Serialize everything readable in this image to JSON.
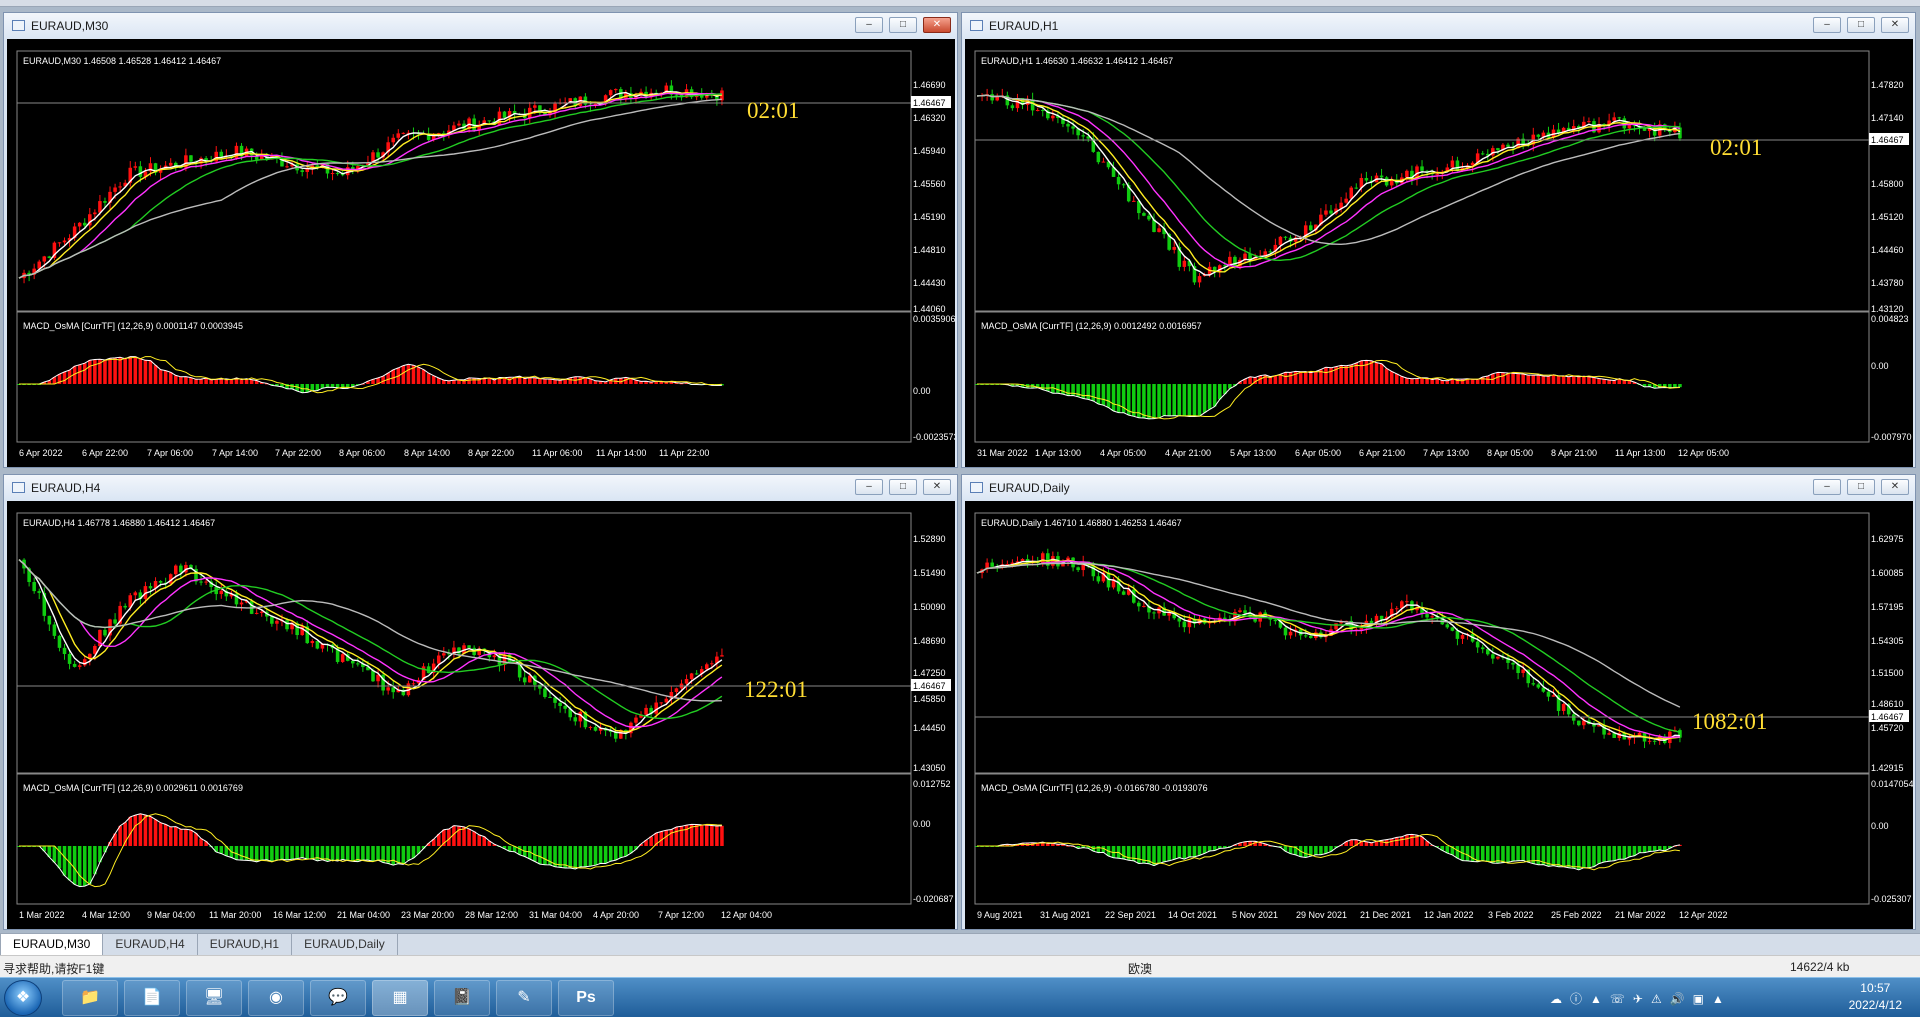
{
  "colors": {
    "bull": "#ff1010",
    "bear": "#10cc10",
    "ma_fast": "#ffffff",
    "ma_mid": "#ffee22",
    "ma_slow": "#ff33ff",
    "ma_slower": "#22cc22",
    "ma_slowest": "#bbbbbb",
    "countdown": "#ffdd33"
  },
  "windows": [
    {
      "title": "EURAUD,M30",
      "info": "EURAUD,M30  1.46508 1.46528 1.46412 1.46467",
      "macd_info": "MACD_OsMA [CurrTF] (12,26,9) 0.0001147 0.0003945",
      "current_price_label": "1.46467",
      "countdown": "02:01",
      "price_ticks": [
        "1.46690",
        "1.46320",
        "1.45940",
        "1.45560",
        "1.45190",
        "1.44810",
        "1.44430",
        "1.44060"
      ],
      "macd_ticks": [
        "0.0035906",
        "0.00",
        "-0.0023573"
      ],
      "time_ticks": [
        "6 Apr 2022",
        "6 Apr 22:00",
        "7 Apr 06:00",
        "7 Apr 14:00",
        "7 Apr 22:00",
        "8 Apr 06:00",
        "8 Apr 14:00",
        "8 Apr 22:00",
        "11 Apr 06:00",
        "11 Apr 14:00",
        "11 Apr 22:00"
      ]
    },
    {
      "title": "EURAUD,H1",
      "info": "EURAUD,H1  1.46630 1.46632 1.46412 1.46467",
      "macd_info": "MACD_OsMA [CurrTF] (12,26,9) 0.0012492 0.0016957",
      "current_price_label": "1.46467",
      "countdown": "02:01",
      "price_ticks": [
        "1.47820",
        "1.47140",
        "1.45800",
        "1.45120",
        "1.44460",
        "1.43780",
        "1.43120"
      ],
      "macd_ticks": [
        "0.004823",
        "0.00",
        "-0.007970"
      ],
      "time_ticks": [
        "31 Mar 2022",
        "1 Apr 13:00",
        "4 Apr 05:00",
        "4 Apr 21:00",
        "5 Apr 13:00",
        "6 Apr 05:00",
        "6 Apr 21:00",
        "7 Apr 13:00",
        "8 Apr 05:00",
        "8 Apr 21:00",
        "11 Apr 13:00",
        "12 Apr 05:00"
      ]
    },
    {
      "title": "EURAUD,H4",
      "info": "EURAUD,H4  1.46778 1.46880 1.46412 1.46467",
      "macd_info": "MACD_OsMA [CurrTF] (12,26,9) 0.0029611 0.0016769",
      "current_price_label": "1.46467",
      "countdown": "122:01",
      "price_ticks": [
        "1.52890",
        "1.51490",
        "1.50090",
        "1.48690",
        "1.47250",
        "1.45850",
        "1.44450",
        "1.43050"
      ],
      "macd_ticks": [
        "0.012752",
        "0.00",
        "-0.020687"
      ],
      "time_ticks": [
        "1 Mar 2022",
        "4 Mar 12:00",
        "9 Mar 04:00",
        "11 Mar 20:00",
        "16 Mar 12:00",
        "21 Mar 04:00",
        "23 Mar 20:00",
        "28 Mar 12:00",
        "31 Mar 04:00",
        "4 Apr 20:00",
        "7 Apr 12:00",
        "12 Apr 04:00"
      ]
    },
    {
      "title": "EURAUD,Daily",
      "info": "EURAUD,Daily  1.46710 1.46880 1.46253 1.46467",
      "macd_info": "MACD_OsMA [CurrTF] (12,26,9) -0.0166780 -0.0193076",
      "current_price_label": "1.46467",
      "countdown": "1082:01",
      "price_ticks": [
        "1.62975",
        "1.60085",
        "1.57195",
        "1.54305",
        "1.51500",
        "1.48610",
        "1.45720",
        "1.42915"
      ],
      "macd_ticks": [
        "0.0147054",
        "0.00",
        "-0.025307"
      ],
      "time_ticks": [
        "9 Aug 2021",
        "31 Aug 2021",
        "22 Sep 2021",
        "14 Oct 2021",
        "5 Nov 2021",
        "29 Nov 2021",
        "21 Dec 2021",
        "12 Jan 2022",
        "3 Feb 2022",
        "25 Feb 2022",
        "21 Mar 2022",
        "12 Apr 2022"
      ]
    }
  ],
  "tabs": [
    "EURAUD,M30",
    "EURAUD,H4",
    "EURAUD,H1",
    "EURAUD,Daily"
  ],
  "status": {
    "help": "寻求帮助,请按F1键",
    "profile": "欧澳",
    "traffic": "14622/4 kb"
  },
  "taskbar": {
    "apps": [
      "folder-app",
      "explorer-app",
      "monitor-app",
      "browser-app",
      "wechat-app",
      "calculator-app",
      "notes-app",
      "pen-app",
      "photoshop-app"
    ],
    "photoshop_label": "Ps",
    "time": "10:57",
    "date": "2022/4/12"
  }
}
